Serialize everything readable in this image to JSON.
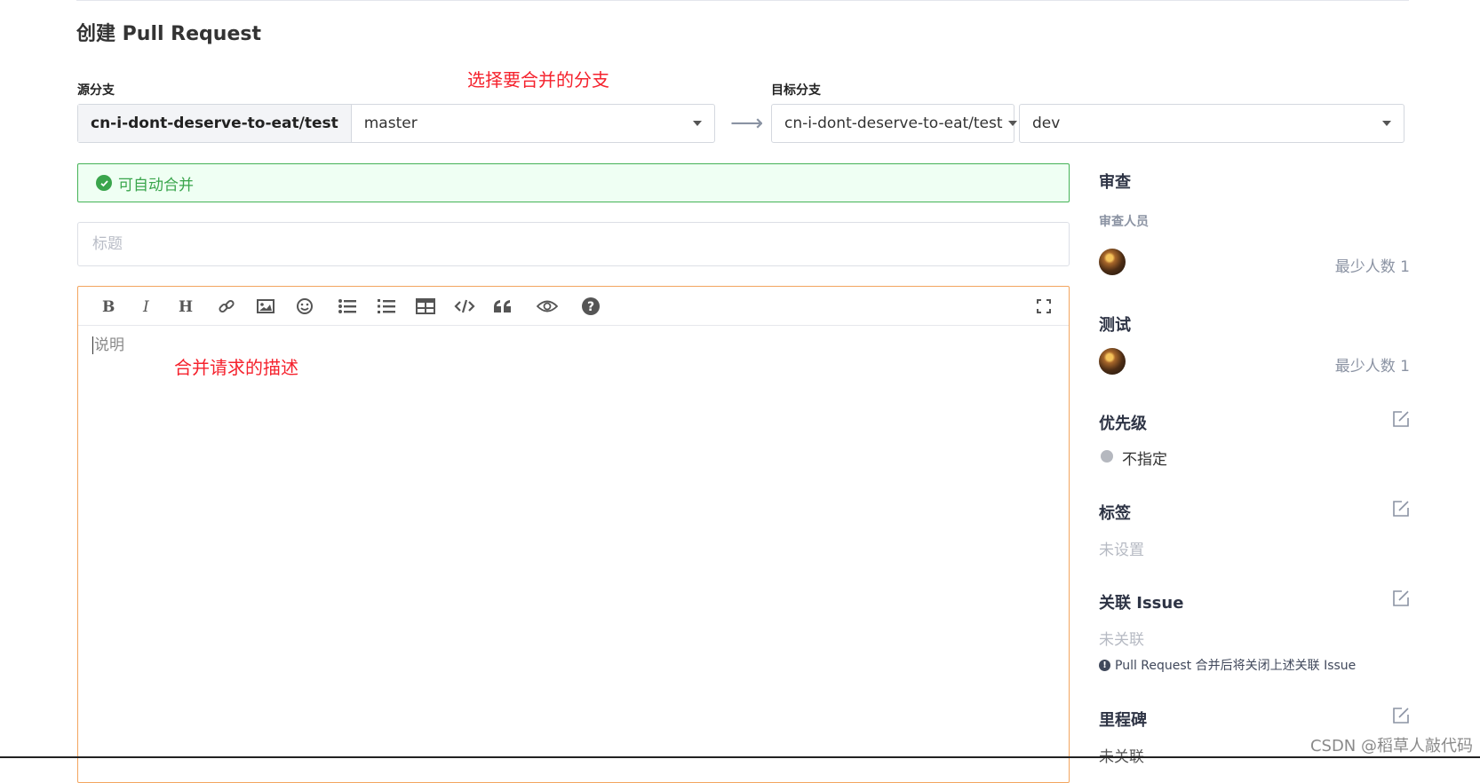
{
  "page": {
    "title": "创建 Pull Request"
  },
  "annotations": {
    "branch_hint": "选择要合并的分支",
    "desc_hint": "合并请求的描述"
  },
  "source": {
    "label": "源分支",
    "repo": "cn-i-dont-deserve-to-eat/test",
    "branch": "master"
  },
  "target": {
    "label": "目标分支",
    "repo": "cn-i-dont-deserve-to-eat/test",
    "branch": "dev"
  },
  "merge_status": {
    "text": "可自动合并",
    "color": "#3aa54c"
  },
  "title_input": {
    "placeholder": "标题",
    "value": ""
  },
  "editor": {
    "toolbar": [
      "bold-icon",
      "italic-icon",
      "heading-icon",
      "link-icon",
      "image-icon",
      "emoji-icon",
      "unordered-list-icon",
      "ordered-list-icon",
      "table-icon",
      "code-icon",
      "quote-icon",
      "preview-icon",
      "help-icon",
      "fullscreen-icon"
    ],
    "placeholder": "说明",
    "border_color": "#f3a55f"
  },
  "sidebar": {
    "review": {
      "heading": "审查",
      "sub": "审查人员",
      "min_count": "最少人数 1"
    },
    "test": {
      "heading": "测试",
      "min_count": "最少人数 1"
    },
    "priority": {
      "heading": "优先级",
      "value": "不指定"
    },
    "labels": {
      "heading": "标签",
      "value": "未设置"
    },
    "issue": {
      "heading": "关联 Issue",
      "value": "未关联",
      "note": "Pull Request 合并后将关闭上述关联 Issue"
    },
    "milestone": {
      "heading": "里程碑",
      "value": "未关联"
    }
  },
  "watermark": "CSDN @稻草人敲代码"
}
